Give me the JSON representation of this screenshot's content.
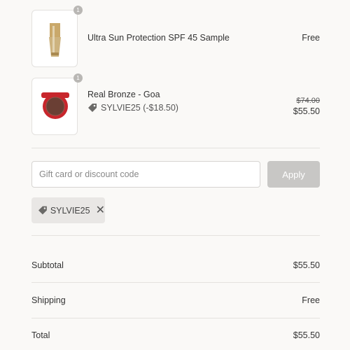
{
  "items": [
    {
      "name": "Ultra Sun Protection SPF 45 Sample",
      "quantity": "1",
      "price": "Free"
    },
    {
      "name": "Real Bronze - Goa",
      "quantity": "1",
      "discount_code": "SYLVIE25 (-$18.50)",
      "original_price": "$74.00",
      "price": "$55.50"
    }
  ],
  "discount": {
    "placeholder": "Gift card or discount code",
    "apply_label": "Apply",
    "applied_code": "SYLVIE25"
  },
  "summary": {
    "subtotal_label": "Subtotal",
    "subtotal_value": "$55.50",
    "shipping_label": "Shipping",
    "shipping_value": "Free",
    "total_label": "Total",
    "total_value": "$55.50"
  },
  "icons": {
    "tag": "tag-icon",
    "remove": "close-icon"
  },
  "colors": {
    "background": "#faf9f7",
    "apply_button": "#c8c7c5",
    "chip": "#e9e7e5",
    "compact_red": "#c8262c"
  }
}
